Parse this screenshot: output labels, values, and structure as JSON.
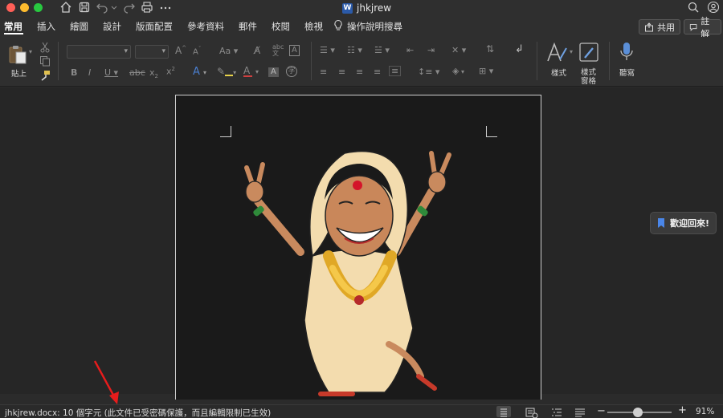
{
  "window": {
    "title": "jhkjrew",
    "controls": {
      "close_color": "#ff5f57",
      "minimize_color": "#febc2e",
      "zoom_color": "#28c840"
    },
    "toolbar_icons": [
      "home-icon",
      "save-icon",
      "undo-icon",
      "redo-icon",
      "print-icon",
      "more-icon"
    ],
    "right_icons": [
      "search-icon",
      "account-icon"
    ]
  },
  "tabs": [
    {
      "label": "常用",
      "active": true
    },
    {
      "label": "插入"
    },
    {
      "label": "繪圖"
    },
    {
      "label": "設計"
    },
    {
      "label": "版面配置"
    },
    {
      "label": "參考資料"
    },
    {
      "label": "郵件"
    },
    {
      "label": "校閱"
    },
    {
      "label": "檢視"
    },
    {
      "label": "操作說明搜尋"
    }
  ],
  "share_label": "共用",
  "comments_label": "註解",
  "ribbon": {
    "paste_label": "貼上",
    "font_name": "",
    "font_size": "",
    "styles_label": "樣式",
    "styles_pane_label_1": "樣式",
    "styles_pane_label_2": "窗格",
    "dictate_label": "聽寫"
  },
  "welcome": {
    "label": "歡迎回來!"
  },
  "status": {
    "text": "jhkjrew.docx: 10 個字元 (此文件已受密碼保護，而且編輯限制已生效)",
    "zoom_level": 0.47,
    "zoom_label": "91%",
    "view_icons": [
      "print-layout-icon",
      "web-layout-icon",
      "outline-icon",
      "draft-icon"
    ]
  }
}
